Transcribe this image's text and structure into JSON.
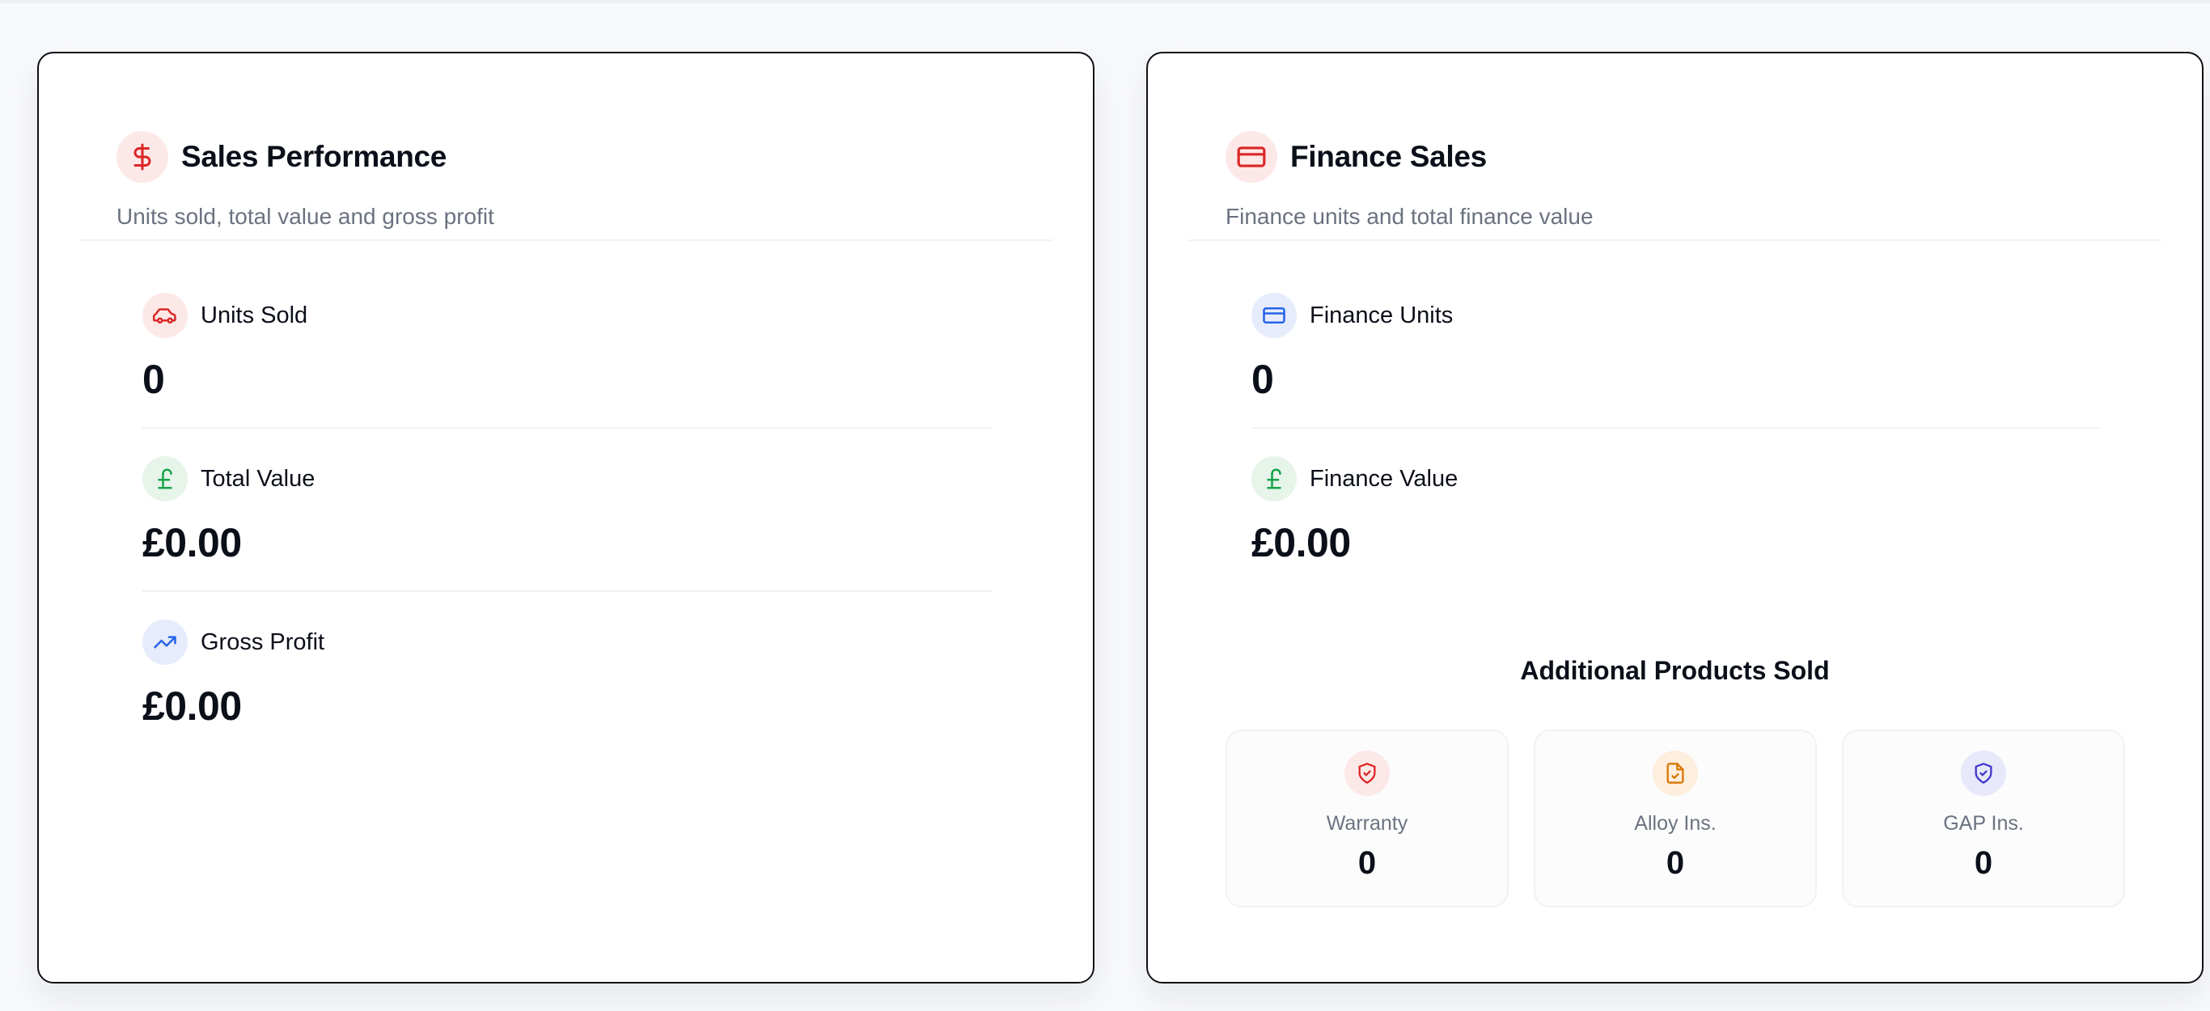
{
  "sales": {
    "title": "Sales Performance",
    "subtitle": "Units sold, total value and gross profit",
    "metrics": [
      {
        "label": "Units Sold",
        "value": "0",
        "icon": "car-icon"
      },
      {
        "label": "Total Value",
        "value": "£0.00",
        "icon": "pound-icon"
      },
      {
        "label": "Gross Profit",
        "value": "£0.00",
        "icon": "trending-up-icon"
      }
    ]
  },
  "finance": {
    "title": "Finance Sales",
    "subtitle": "Finance units and total finance value",
    "metrics": [
      {
        "label": "Finance Units",
        "value": "0",
        "icon": "credit-card-icon"
      },
      {
        "label": "Finance Value",
        "value": "£0.00",
        "icon": "pound-icon"
      }
    ],
    "additional": {
      "title": "Additional Products Sold",
      "items": [
        {
          "label": "Warranty",
          "value": "0",
          "icon": "shield-check-icon",
          "color": "#dc2626"
        },
        {
          "label": "Alloy Ins.",
          "value": "0",
          "icon": "file-check-icon",
          "color": "#d97706"
        },
        {
          "label": "GAP Ins.",
          "value": "0",
          "icon": "shield-check-icon",
          "color": "#4338ca"
        }
      ]
    }
  },
  "colors": {
    "red": "#dc2626",
    "green": "#16a34a",
    "blue": "#2563eb",
    "muted": "#6b7280"
  }
}
